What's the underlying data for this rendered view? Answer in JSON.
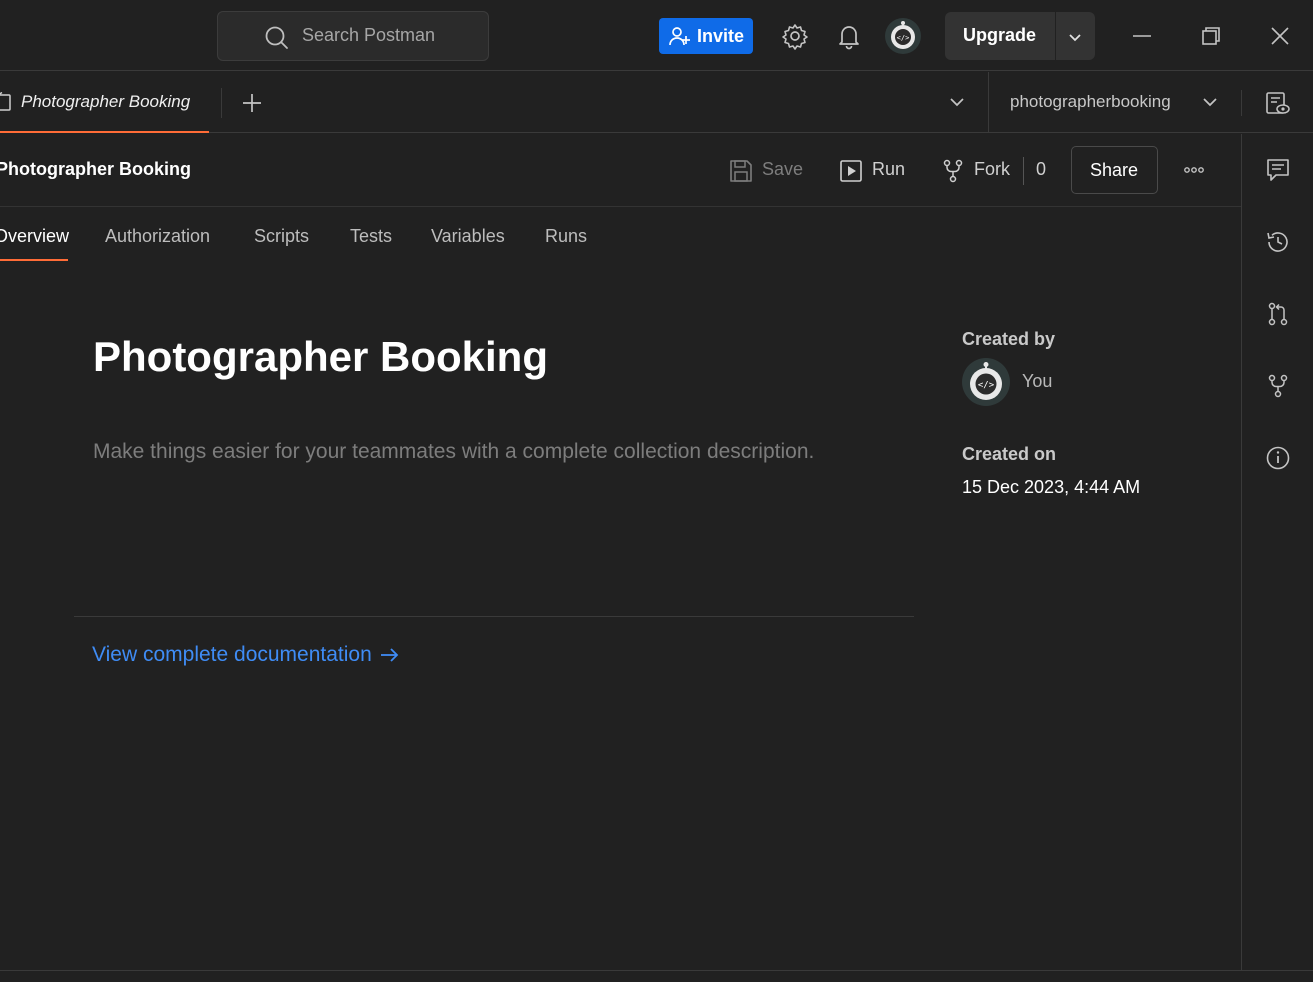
{
  "titlebar": {
    "search_placeholder": "Search Postman",
    "invite_label": "Invite",
    "upgrade_label": "Upgrade",
    "accent_color": "#0f6be8"
  },
  "tabbar": {
    "active_tab": "Photographer Booking",
    "environment": "photographerbooking"
  },
  "collection": {
    "name": "Photographer Booking",
    "actions": {
      "save": "Save",
      "run": "Run",
      "fork": "Fork",
      "fork_count": "0",
      "share": "Share"
    },
    "subtabs": [
      "Overview",
      "Authorization",
      "Scripts",
      "Tests",
      "Variables",
      "Runs"
    ],
    "active_subtab": "Overview"
  },
  "overview": {
    "title": "Photographer Booking",
    "description_placeholder": "Make things easier for your teammates with a complete collection description.",
    "view_docs_link": "View complete documentation",
    "created_by_label": "Created by",
    "created_by": "You",
    "created_on_label": "Created on",
    "created_on": "15 Dec 2023, 4:44 AM"
  },
  "colors": {
    "background": "#212121",
    "active_tab_underline": "#ff6c37",
    "link": "#3f8cf5"
  }
}
